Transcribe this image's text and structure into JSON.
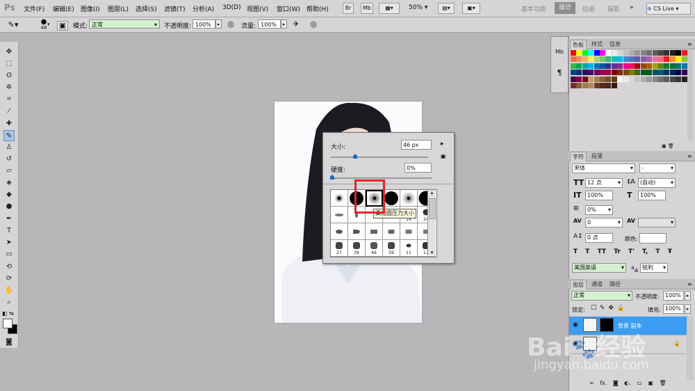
{
  "app": {
    "logo": "Ps"
  },
  "menu": [
    "文件(F)",
    "编辑(E)",
    "图像(I)",
    "图层(L)",
    "选择(S)",
    "滤镜(T)",
    "分析(A)",
    "3D(D)",
    "视图(V)",
    "窗口(W)",
    "帮助(H)"
  ],
  "topbar": {
    "br": "Br",
    "mb": "Mb",
    "zoom": "50%",
    "workspaces": [
      "基本功能",
      "设计",
      "绘画",
      "摄影"
    ],
    "active_workspace": "设计",
    "cslive": "CS Live"
  },
  "options": {
    "brush_size": "46",
    "mode_label": "模式:",
    "mode_value": "正常",
    "opacity_label": "不透明度:",
    "opacity_value": "100%",
    "flow_label": "流量:",
    "flow_value": "100%"
  },
  "picker": {
    "size_label": "大小:",
    "size_value": "46 px",
    "hardness_label": "硬度:",
    "hardness_value": "0%",
    "size_slider": 0.25,
    "hardness_slider": 0.0,
    "tooltip": "柔边圆压力大小",
    "row2_nums": [
      "",
      "",
      "",
      "",
      "14",
      "24"
    ],
    "row4_nums": [
      "27",
      "39",
      "46",
      "59",
      "11",
      "17"
    ]
  },
  "panels": {
    "swatch_tabs": [
      "色板",
      "样式",
      "信息"
    ],
    "char_tabs": [
      "字符",
      "段落"
    ],
    "font_family": "宋体",
    "font_style": "-",
    "font_size": "12 点",
    "leading": "(自动)",
    "vscale": "100%",
    "hscale": "100%",
    "tracking_ratio": "0%",
    "kerning": "0",
    "baseline": "0 点",
    "color_label": "颜色:",
    "type_btns": [
      "T",
      "T",
      "TT",
      "Tr",
      "T'",
      "T,",
      "T",
      "Ŧ"
    ],
    "language": "美国英语",
    "aa_label": "a",
    "aa_value": "锐利",
    "layer_tabs": [
      "图层",
      "通道",
      "路径"
    ],
    "blend_mode": "正常",
    "layer_opacity_label": "不透明度:",
    "layer_opacity": "100%",
    "lock_label": "锁定:",
    "fill_label": "填充:",
    "fill_value": "100%",
    "layers": [
      {
        "name": "背景 副本",
        "selected": true
      },
      {
        "name": "",
        "selected": false
      }
    ],
    "bottom_icons": [
      "link-icon",
      "fx-icon",
      "mask-icon",
      "adjust-icon",
      "folder-icon",
      "new-layer-icon",
      "trash-icon"
    ]
  },
  "colors": {
    "accent": "#3d9df3",
    "highlight_box": "#e0262a"
  },
  "watermark": {
    "line1": "Bai",
    "line2": "经验",
    "line3": "jingyan.baidu.com"
  }
}
